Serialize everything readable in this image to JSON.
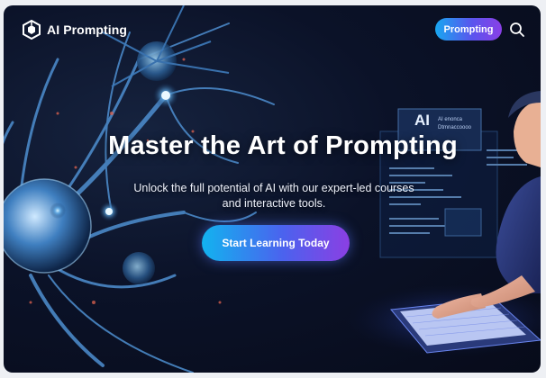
{
  "brand": {
    "name": "AI Prompting",
    "logo_icon": "cube-logo-icon"
  },
  "nav": {
    "button_label": "Prompting",
    "search_icon": "search-icon"
  },
  "hero": {
    "title": "Master the Art of Prompting",
    "subtitle_line1": "Unlock the full potential of AI with our expert-led courses",
    "subtitle_line2": "and interactive tools.",
    "cta_label": "Start Learning Today"
  },
  "illustration": {
    "screen_badge": "AI",
    "screen_text_line1": "AI enonca",
    "screen_text_line2": "Dtmnaccoooo"
  },
  "colors": {
    "accent_cyan": "#12b3ef",
    "accent_purple": "#8b3fe3",
    "background": "#0b1228"
  }
}
